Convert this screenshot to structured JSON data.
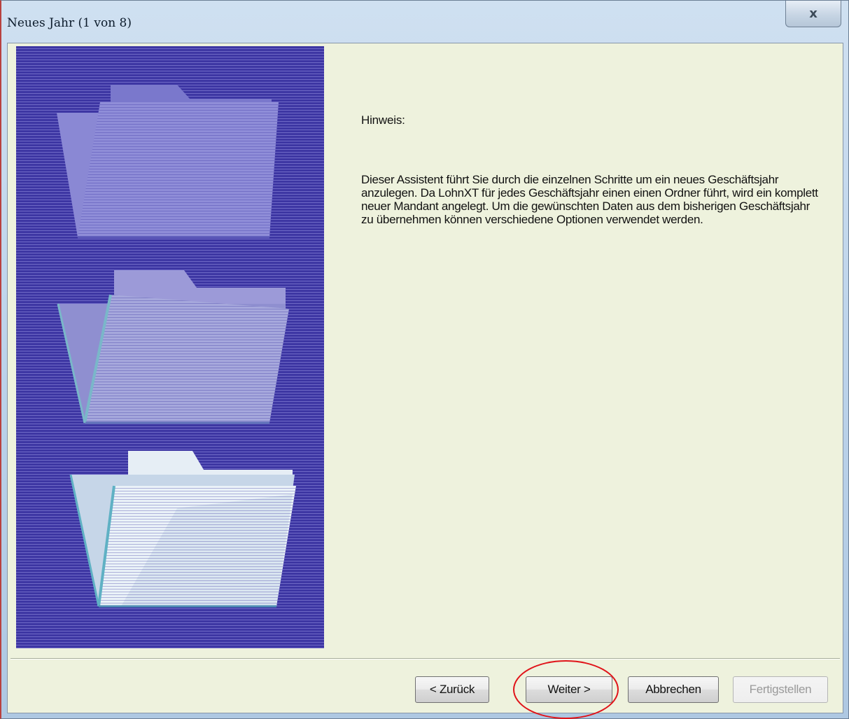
{
  "window": {
    "title": "Neues Jahr (1 von 8)",
    "close_symbol": "x"
  },
  "content": {
    "hint_label": "Hinweis:",
    "hint_text": "Dieser Assistent führt Sie durch die einzelnen Schritte um ein neues Geschäftsjahr anzulegen. Da LohnXT für jedes Geschäftsjahr einen einen Ordner führt, wird ein komplett neuer Mandant angelegt. Um die gewünschten Daten aus dem bisherigen Geschäftsjahr zu übernehmen können verschiedene Optionen verwendet werden."
  },
  "buttons": {
    "back": "< Zurück",
    "next": "Weiter >",
    "cancel": "Abbrechen",
    "finish": "Fertigstellen"
  },
  "side_panel": {
    "icons": [
      "folder-closed-icon",
      "folder-half-open-icon",
      "folder-open-icon"
    ]
  },
  "colors": {
    "panel_background": "#3d36a3",
    "highlight_ring": "#e0141a",
    "client_background": "#eef2dd"
  }
}
